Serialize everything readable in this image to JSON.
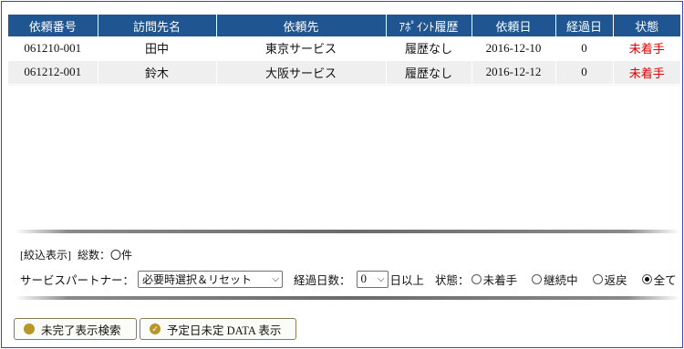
{
  "grid": {
    "columns": [
      "依頼番号",
      "訪問先名",
      "依頼先",
      "ｱﾎﾟｲﾝﾄ履歴",
      "依頼日",
      "経過日",
      "状態"
    ],
    "rows": [
      [
        "061210-001",
        "田中",
        "東京サービス",
        "履歴なし",
        "2016-12-10",
        "0",
        "未着手"
      ],
      [
        "061212-001",
        "鈴木",
        "大阪サービス",
        "履歴なし",
        "2016-12-12",
        "0",
        "未着手"
      ]
    ]
  },
  "filter": {
    "section_label": "[絞込表示]",
    "total_label": "総数：〇件",
    "partner_label": "サービスパートナー：",
    "partner_value": "必要時選択＆リセット",
    "days_label": "経過日数：",
    "days_value": "0",
    "days_suffix": "日以上",
    "status_label": "状態：",
    "status_options": [
      "未着手",
      "継続中",
      "返戻",
      "全て"
    ],
    "status_selected": "全て"
  },
  "buttons": {
    "incomplete_search": "未完了表示検索",
    "undetermined_data": "予定日未定 DATA 表示"
  },
  "colors": {
    "header_bg": "#1f5591",
    "status_red": "#e00000",
    "frame_border": "#3a46b8",
    "button_icon": "#b8962a"
  }
}
